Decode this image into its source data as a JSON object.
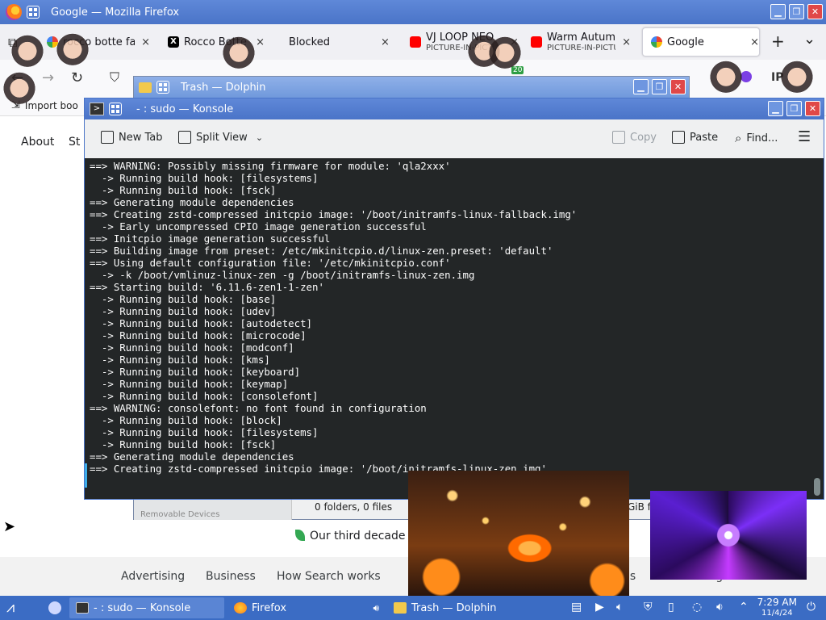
{
  "firefox": {
    "window_title": "Google — Mozilla Firefox",
    "tabs": [
      {
        "label": "rocco botte fa",
        "close": "×"
      },
      {
        "label": "Rocco Botte o",
        "close": "×"
      },
      {
        "label": "Blocked",
        "close": "×"
      },
      {
        "label": "VJ LOOP NEO",
        "sub": "PICTURE-IN-PICTU",
        "close": "×"
      },
      {
        "label": "Warm Autumn",
        "sub": "PICTURE-IN-PICTU",
        "close": "×"
      },
      {
        "label": "Google",
        "close": "×"
      }
    ],
    "new_tab": "+",
    "list_tabs": "⌄",
    "bookmark": "Import boo",
    "badge": "20"
  },
  "google_page": {
    "top_links": [
      "About",
      "St"
    ],
    "tagline": "Our third decade o",
    "footer_links": [
      "Advertising",
      "Business",
      "How Search works",
      "ns",
      "Settings"
    ],
    "partial_gib": "GiB fr",
    "partial_label": "Removable Devices"
  },
  "dolphin": {
    "window_title": "Trash — Dolphin",
    "status": "0 folders, 0 files"
  },
  "konsole": {
    "window_title": "- : sudo — Konsole",
    "toolbar": {
      "new_tab": "New Tab",
      "split_view": "Split View",
      "copy": "Copy",
      "paste": "Paste",
      "find": "Find..."
    },
    "terminal_lines": [
      "==> WARNING: Possibly missing firmware for module: 'qla2xxx'",
      "  -> Running build hook: [filesystems]",
      "  -> Running build hook: [fsck]",
      "==> Generating module dependencies",
      "==> Creating zstd-compressed initcpio image: '/boot/initramfs-linux-fallback.img'",
      "  -> Early uncompressed CPIO image generation successful",
      "==> Initcpio image generation successful",
      "==> Building image from preset: /etc/mkinitcpio.d/linux-zen.preset: 'default'",
      "==> Using default configuration file: '/etc/mkinitcpio.conf'",
      "  -> -k /boot/vmlinuz-linux-zen -g /boot/initramfs-linux-zen.img",
      "==> Starting build: '6.11.6-zen1-1-zen'",
      "  -> Running build hook: [base]",
      "  -> Running build hook: [udev]",
      "  -> Running build hook: [autodetect]",
      "  -> Running build hook: [microcode]",
      "  -> Running build hook: [modconf]",
      "  -> Running build hook: [kms]",
      "  -> Running build hook: [keyboard]",
      "  -> Running build hook: [keymap]",
      "  -> Running build hook: [consolefont]",
      "==> WARNING: consolefont: no font found in configuration",
      "  -> Running build hook: [block]",
      "  -> Running build hook: [filesystems]",
      "  -> Running build hook: [fsck]",
      "==> Generating module dependencies",
      "==> Creating zstd-compressed initcpio image: '/boot/initramfs-linux-zen.img'"
    ]
  },
  "taskbar": {
    "tasks": [
      {
        "label": "- : sudo — Konsole"
      },
      {
        "label": "Firefox"
      },
      {
        "label": "Trash — Dolphin"
      }
    ],
    "clock_time": "7:29 AM",
    "clock_date": "11/4/24"
  },
  "colors": {
    "titlebar": "#4a74c8",
    "terminal_bg": "#232627",
    "taskbar": "#3b6cc4"
  }
}
